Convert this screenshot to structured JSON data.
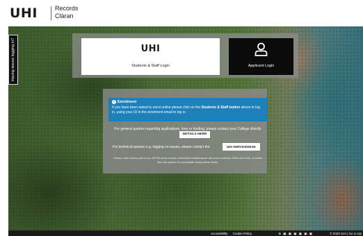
{
  "header": {
    "logo": "UHI",
    "title_line1": "Records",
    "title_line2": "Clàran"
  },
  "help_tab": {
    "label": "Having issues logging in?"
  },
  "login": {
    "student": {
      "logo": "UHI",
      "label": "Students & Staff Login"
    },
    "applicant": {
      "label": "Applicant Login",
      "icon": "user-icon"
    }
  },
  "enrolment": {
    "title": "Enrolment",
    "text_before": "If you have been asked to enrol online please click on the ",
    "text_bold": "Students & Staff button",
    "text_after": " above to log in, using your ID in the enrolment email to log in."
  },
  "general_query": {
    "text": "For general queries regarding applications, fees or funding, please contact your College directly",
    "button": "DETAILS HERE"
  },
  "tech_query": {
    "text": "For technical queries e.g. logging on issues, please contact the",
    "button": "UHI SERVICEDESK"
  },
  "footnote": "Please note that as part of our UHI Records routine, scheduled maintenance will occur between 0000 and 0200, at which time the system is unavailable during these times.",
  "footer": {
    "links": [
      "Accessibility",
      "Cookie Policy"
    ],
    "socials": "⊕ ▣ ▣ ▣ ▣ ▣ ▣",
    "copyright": "© 2023 UHI | Go to top"
  },
  "colors": {
    "enrol_blue": "#1f7fb8",
    "applicant_black": "#0b0b0b",
    "panel_grey": "#8c8c8c"
  }
}
